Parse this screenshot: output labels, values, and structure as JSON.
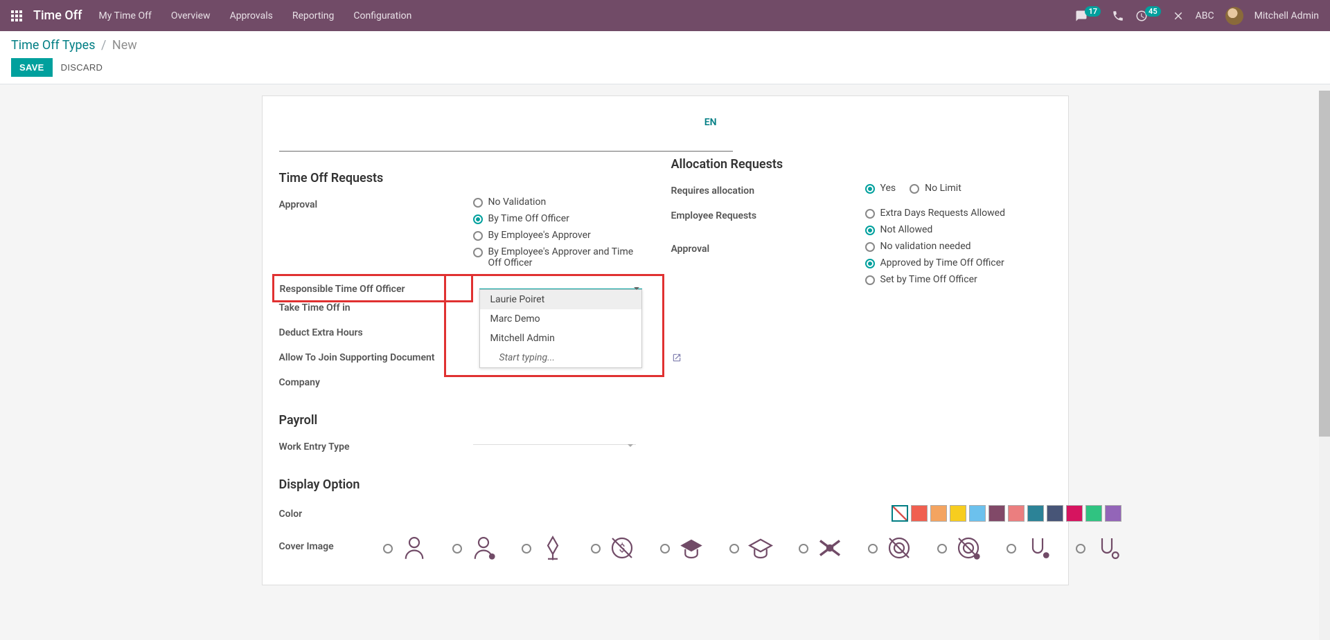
{
  "navbar": {
    "title": "Time Off",
    "menu": [
      "My Time Off",
      "Overview",
      "Approvals",
      "Reporting",
      "Configuration"
    ],
    "msg_count": "17",
    "activity_count": "45",
    "abc": "ABC",
    "user": "Mitchell Admin"
  },
  "breadcrumb": {
    "link": "Time Off Types",
    "current": "New"
  },
  "buttons": {
    "save": "SAVE",
    "discard": "DISCARD"
  },
  "lang_tag": "EN",
  "sections": {
    "time_off_requests": "Time Off Requests",
    "allocation_requests": "Allocation Requests",
    "payroll": "Payroll",
    "display_option": "Display Option"
  },
  "labels": {
    "approval": "Approval",
    "responsible": "Responsible Time Off Officer",
    "take_in": "Take Time Off in",
    "deduct": "Deduct Extra Hours",
    "allow_join": "Allow To Join Supporting Document",
    "company": "Company",
    "work_entry": "Work Entry Type",
    "color": "Color",
    "cover_image": "Cover Image",
    "requires_allocation": "Requires allocation",
    "employee_requests": "Employee Requests",
    "alloc_approval": "Approval"
  },
  "approval_options": [
    "No Validation",
    "By Time Off Officer",
    "By Employee's Approver",
    "By Employee's Approver and Time Off Officer"
  ],
  "approval_selected": 1,
  "dropdown": {
    "options": [
      "Laurie Poiret",
      "Marc Demo",
      "Mitchell Admin"
    ],
    "start_typing": "Start typing..."
  },
  "requires_allocation_options": [
    "Yes",
    "No Limit"
  ],
  "requires_allocation_selected": 0,
  "employee_requests_options": [
    "Extra Days Requests Allowed",
    "Not Allowed"
  ],
  "employee_requests_selected": 1,
  "alloc_approval_options": [
    "No validation needed",
    "Approved by Time Off Officer",
    "Set by Time Off Officer"
  ],
  "alloc_approval_selected": 1,
  "colors": [
    "none",
    "#f06050",
    "#f4a460",
    "#f7cd1f",
    "#6cc1ed",
    "#814968",
    "#eb7e7f",
    "#2c8397",
    "#475577",
    "#d6145f",
    "#30c381",
    "#9365b8"
  ]
}
